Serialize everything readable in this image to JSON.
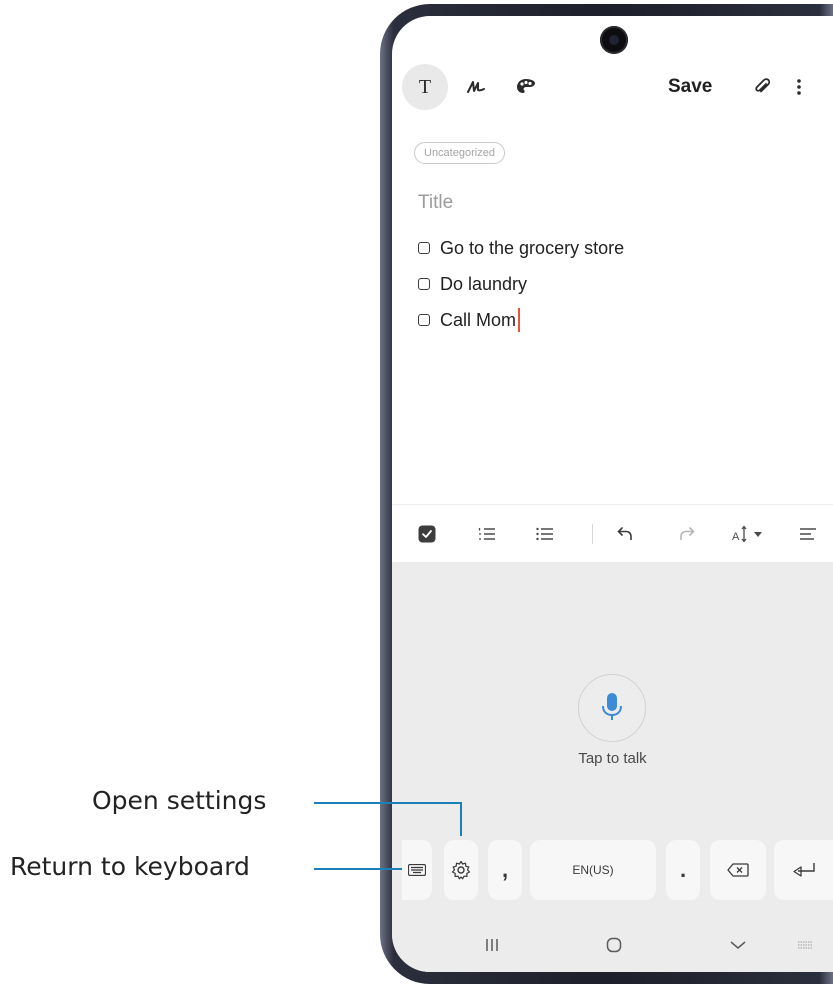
{
  "callouts": {
    "open_settings": "Open settings",
    "return_to_keyboard": "Return to keyboard"
  },
  "editor": {
    "text_mode_label": "T",
    "save_label": "Save",
    "tag_label": "Uncategorized",
    "title_placeholder": "Title",
    "checklist": [
      "Go to the grocery store",
      "Do laundry",
      "Call Mom"
    ]
  },
  "voice_input": {
    "prompt": "Tap to talk",
    "keys": {
      "comma": ",",
      "language": "EN(US)",
      "period": "."
    }
  },
  "colors": {
    "callout_line": "#1b7fb8",
    "mic_icon": "#3d8ad6",
    "cursor": "#e8533c"
  },
  "icons": [
    "text-mode-icon",
    "handwriting-icon",
    "palette-icon",
    "attach-icon",
    "more-options-icon",
    "checklist-icon",
    "numbered-list-icon",
    "bullet-list-icon",
    "undo-icon",
    "redo-icon",
    "font-size-icon",
    "align-icon",
    "mic-icon",
    "keyboard-icon",
    "settings-icon",
    "backspace-icon",
    "enter-icon",
    "recents-icon",
    "home-icon",
    "back-icon",
    "keyboard-toggle-icon"
  ]
}
